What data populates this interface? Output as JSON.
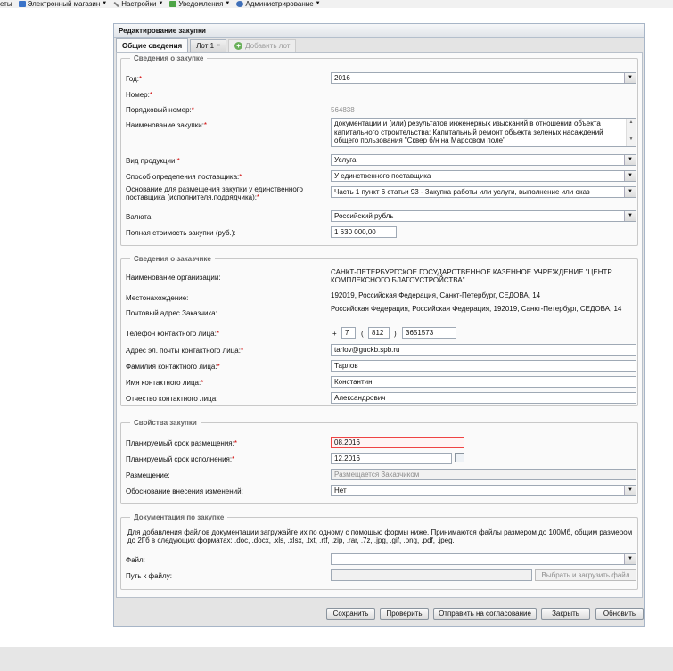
{
  "menubar": {
    "items": [
      {
        "label": "еты",
        "icon": ""
      },
      {
        "label": "Электронный магазин",
        "icon": "shop-icon",
        "dropdown": true
      },
      {
        "label": "Настройки",
        "icon": "wrench-icon",
        "dropdown": true
      },
      {
        "label": "Уведомления",
        "icon": "notification-icon",
        "dropdown": true
      },
      {
        "label": "Администрирование",
        "icon": "user-admin-icon",
        "dropdown": true
      }
    ]
  },
  "panel": {
    "title": "Редактирование закупки"
  },
  "tabs": [
    {
      "label": "Общие сведения",
      "active": true
    },
    {
      "label": "Лот 1",
      "active": false,
      "close": "×"
    },
    {
      "label": "Добавить лот",
      "disabled": true
    }
  ],
  "section1": {
    "legend": "Сведения о закупке",
    "year_label": "Год:",
    "year_value": "2016",
    "number_label": "Номер:",
    "order_label": "Порядковый номер:",
    "order_value": "564838",
    "name_label": "Наименование закупки:",
    "name_value": "документации и (или) результатов инженерных изысканий в отношении объекта капитального строительства: Капитальный ремонт объекта зеленых насаждений общего пользования \"Сквер б/н на Марсовом поле\"",
    "product_label": "Вид продукции:",
    "product_value": "Услуга",
    "method_label": "Способ определения поставщика:",
    "method_value": "У единственного поставщика",
    "basis_label": "Основание для размещения закупки у единственного поставщика (исполнителя,подрядчика):",
    "basis_value": "Часть 1 пункт 6 статьи 93 -  Закупка работы или услуги, выполнение или оказ",
    "currency_label": "Валюта:",
    "currency_value": "Российский рубль",
    "cost_label": "Полная стоимость закупки (руб.):",
    "cost_value": "1 630 000,00"
  },
  "section2": {
    "legend": "Сведения о заказчике",
    "org_label": "Наименование организации:",
    "org_value": "САНКТ-ПЕТЕРБУРГСКОЕ ГОСУДАРСТВЕННОЕ КАЗЕННОЕ УЧРЕЖДЕНИЕ \"ЦЕНТР КОМПЛЕКСНОГО БЛАГОУСТРОЙСТВА\"",
    "location_label": "Местонахождение:",
    "location_value": "192019, Российская Федерация, Санкт-Петербург, СЕДОВА, 14",
    "postal_label": "Почтовый адрес Заказчика:",
    "postal_value": "Российская Федерация, Российская Федерация, 192019, Санкт-Петербург, СЕДОВА, 14",
    "phone_label": "Телефон контактного лица:",
    "phone_plus": "+",
    "phone_country": "7",
    "phone_open": "(",
    "phone_code": "812",
    "phone_close": ")",
    "phone_number": "3651573",
    "email_label": "Адрес эл. почты контактного лица:",
    "email_value": "tarlov@guckb.spb.ru",
    "lastname_label": "Фамилия контактного лица:",
    "lastname_value": "Тарлов",
    "firstname_label": "Имя контактного лица:",
    "firstname_value": "Константин",
    "patronymic_label": "Отчество контактного лица:",
    "patronymic_value": "Александрович"
  },
  "section3": {
    "legend": "Свойства закупки",
    "placement_date_label": "Планируемый срок размещения:",
    "placement_date_value": "08.2016",
    "execution_date_label": "Планируемый срок исполнения:",
    "execution_date_value": "12.2016",
    "placement_label": "Размещение:",
    "placement_value": "Размещается Заказчиком",
    "reason_label": "Обоснование внесения изменений:",
    "reason_value": "Нет"
  },
  "section4": {
    "legend": "Документация по закупке",
    "info": "Для добавления файлов документации загружайте их по одному с помощью формы ниже. Принимаются файлы размером до 100Мб, общим размером до 2Гб в следующих форматах: .doc, .docx, .xls, .xlsx, .txt, .rtf, .zip, .rar, .7z, .jpg, .gif, .png, .pdf, .jpeg.",
    "file_label": "Файл:",
    "file_value": "",
    "path_label": "Путь к файлу:",
    "path_value": "",
    "upload_label": "Выбрать и загрузить файл"
  },
  "buttons": {
    "save": "Сохранить",
    "check": "Проверить",
    "send": "Отправить на согласование",
    "close": "Закрыть",
    "refresh": "Обновить"
  },
  "required_mark": "*",
  "colors": {
    "required": "#d00000",
    "error_border": "#ee4444"
  }
}
